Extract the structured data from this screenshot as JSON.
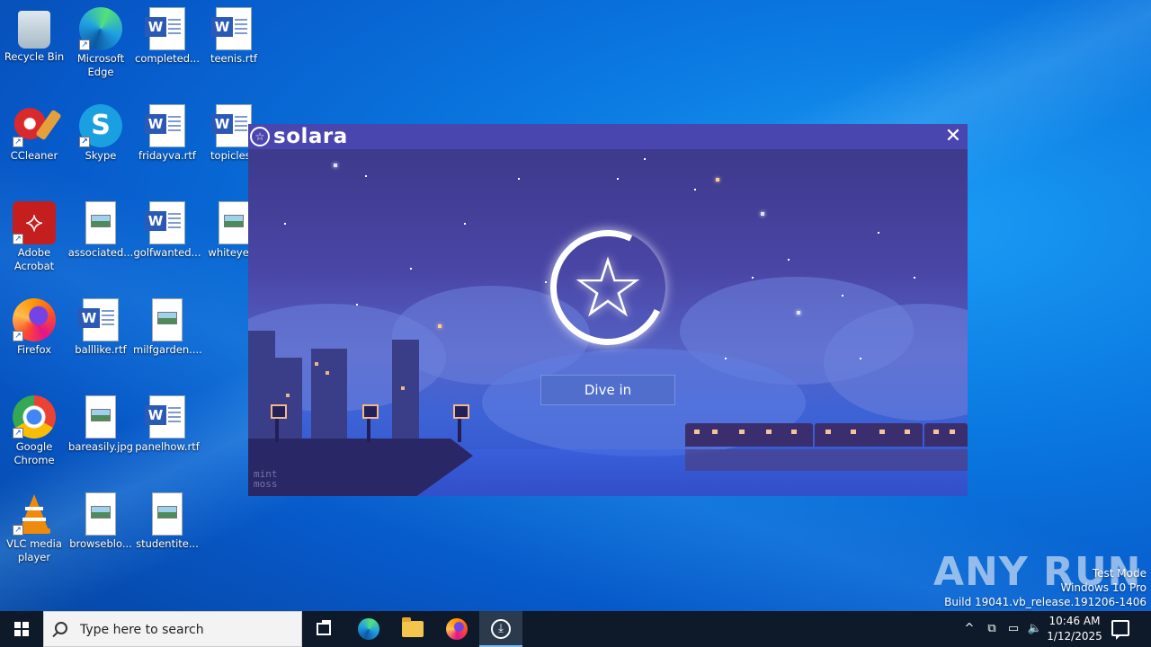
{
  "desktop": {
    "icons": [
      {
        "label": "Recycle Bin"
      },
      {
        "label": "Microsoft Edge"
      },
      {
        "label": "completed..."
      },
      {
        "label": "teenis.rtf"
      },
      {
        "label": "CCleaner"
      },
      {
        "label": "Skype"
      },
      {
        "label": "fridayva.rtf"
      },
      {
        "label": "topiclesb"
      },
      {
        "label": "Adobe Acrobat"
      },
      {
        "label": "associated..."
      },
      {
        "label": "golfwanted..."
      },
      {
        "label": "whiteyear"
      },
      {
        "label": "Firefox"
      },
      {
        "label": "balllike.rtf"
      },
      {
        "label": "milfgarden...."
      },
      {
        "label": "Google Chrome"
      },
      {
        "label": "bareasily.jpg"
      },
      {
        "label": "panelhow.rtf"
      },
      {
        "label": "VLC media player"
      },
      {
        "label": "browseblo..."
      },
      {
        "label": "studentite..."
      }
    ]
  },
  "solara": {
    "brand": "solara",
    "close": "✕",
    "dive_in": "Dive in",
    "watermark": "mint\nmoss"
  },
  "taskbar": {
    "search_placeholder": "Type here to search",
    "time": "10:46 AM",
    "date": "1/12/2025"
  },
  "watermark": {
    "brand": "ANY RUN",
    "mode": "Test Mode",
    "os": "Windows 10 Pro",
    "build": "Build 19041.vb_release.191206-1406"
  }
}
